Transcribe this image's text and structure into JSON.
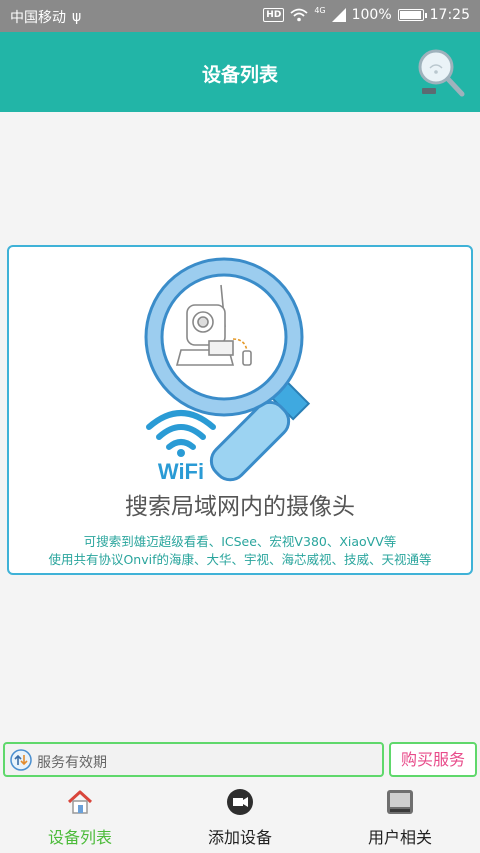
{
  "status_bar": {
    "carrier": "中国移动",
    "usb_symbol": "ψ",
    "hd": "HD",
    "network": "4G",
    "battery_text": "100%",
    "battery_level": 1.0,
    "time": "17:25"
  },
  "header": {
    "title": "设备列表",
    "search_icon": "search-wifi-icon"
  },
  "card": {
    "wifi_label": "WiFi",
    "main_text": "搜索局域网内的摄像头",
    "sub_text_1": "可搜索到雄迈超级看看、ICSee、宏视V380、XiaoVV等",
    "sub_text_2": "使用共有协议Onvif的海康、大华、宇视、海芯威视、技威、天视通等"
  },
  "service": {
    "field_text": "服务有效期",
    "buy_label": "购买服务"
  },
  "nav": {
    "items": [
      {
        "label": "设备列表",
        "icon": "home-icon",
        "active": true
      },
      {
        "label": "添加设备",
        "icon": "camera-icon",
        "active": false
      },
      {
        "label": "用户相关",
        "icon": "user-card-icon",
        "active": false
      }
    ]
  },
  "colors": {
    "header": "#22b5a7",
    "card_border": "#3fb2d7",
    "accent_green": "#4cbb3a",
    "buy_text": "#e84b8a",
    "sub_text": "#2aa59d"
  }
}
